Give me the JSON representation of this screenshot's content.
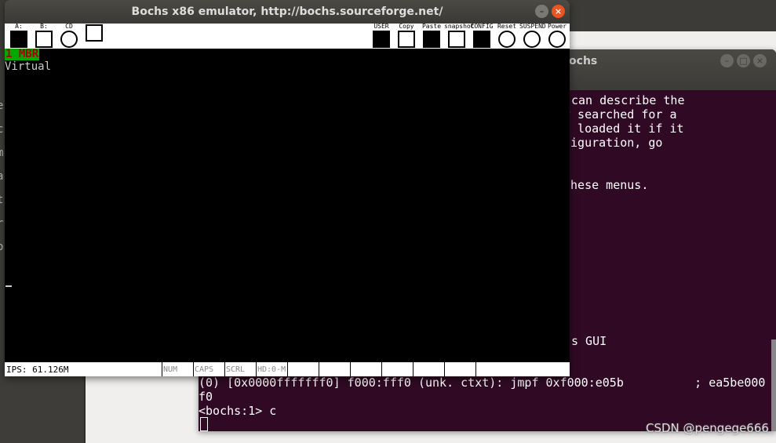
{
  "bochs": {
    "title": "Bochs x86 emulator, http://bochs.sourceforge.net/",
    "toolbar_left": [
      {
        "label": "A:",
        "icon": "floppy-a-icon"
      },
      {
        "label": "B:",
        "icon": "floppy-b-icon"
      },
      {
        "label": "CD",
        "icon": "cdrom-icon"
      },
      {
        "label": "",
        "icon": "mouse-icon"
      }
    ],
    "toolbar_right": [
      {
        "label": "USER",
        "icon": "keyboard-icon"
      },
      {
        "label": "Copy",
        "icon": "copy-icon"
      },
      {
        "label": "Paste",
        "icon": "paste-icon"
      },
      {
        "label": "snapshot",
        "icon": "camera-icon"
      },
      {
        "label": "CONFIG",
        "icon": "config-icon"
      },
      {
        "label": "Reset",
        "icon": "reset-icon"
      },
      {
        "label": "SUSPEND",
        "icon": "suspend-icon"
      },
      {
        "label": "Power",
        "icon": "power-icon"
      }
    ],
    "screen": {
      "line1": "1 MBR",
      "line2": "Virtual"
    },
    "status": {
      "ips": "IPS: 61.126M",
      "cells": [
        "NUM",
        "CAPS",
        "SCRL",
        "HD:0-M",
        "",
        "",
        "",
        "",
        "",
        "",
        ""
      ]
    }
  },
  "terminal": {
    "title": "bochs",
    "lines": [
      "can describe the",
      "y searched for a",
      "d loaded it if it",
      "figuration, go",
      "",
      "",
      "these menus.",
      "s GUI"
    ],
    "output": [
      "(0) [0x0000fffffff0] f000:fff0 (unk. ctxt): jmpf 0xf000:e05b          ; ea5be000",
      "f0",
      "<bochs:1> c"
    ]
  },
  "left_partial_chars": [
    "e",
    "c",
    "m",
    "a",
    "t",
    "r",
    "o"
  ],
  "watermark": "CSDN @pengege666",
  "colors": {
    "terminal_bg": "#300a24",
    "close_button": "#e95420",
    "mbr_bg": "#00a800",
    "mbr_fg": "#a80000"
  }
}
